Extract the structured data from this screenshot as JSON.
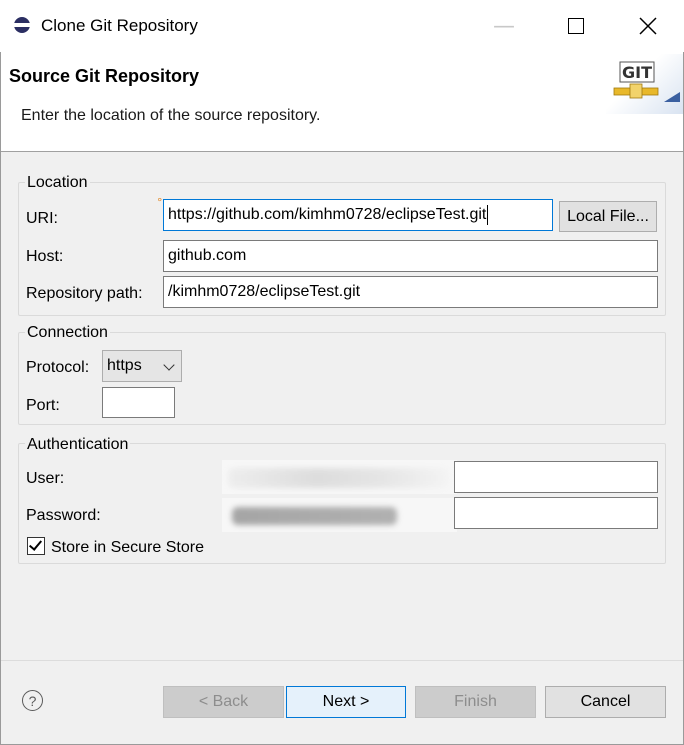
{
  "window": {
    "title": "Clone Git Repository",
    "controls": {
      "minimize": "minimize-icon",
      "maximize": "maximize-icon",
      "close": "close-icon"
    }
  },
  "header": {
    "title": "Source Git Repository",
    "description": "Enter the location of the source repository.",
    "logo_text": "GIT"
  },
  "location": {
    "group_label": "Location",
    "uri_label": "URI:",
    "uri_value": "https://github.com/kimhm0728/eclipseTest.git",
    "local_file_button": "Local File...",
    "host_label": "Host:",
    "host_value": "github.com",
    "repo_path_label": "Repository path:",
    "repo_path_value": "/kimhm0728/eclipseTest.git"
  },
  "connection": {
    "group_label": "Connection",
    "protocol_label": "Protocol:",
    "protocol_value": "https",
    "port_label": "Port:",
    "port_value": ""
  },
  "authentication": {
    "group_label": "Authentication",
    "user_label": "User:",
    "password_label": "Password:",
    "store_label": "Store in Secure Store",
    "store_checked": true
  },
  "footer": {
    "help_icon": "help-icon",
    "back_button": "< Back",
    "next_button": "Next >",
    "finish_button": "Finish",
    "cancel_button": "Cancel"
  },
  "colors": {
    "accent": "#0078d7",
    "dialog_bg": "#f0f0f0",
    "banner_bg": "#ffffff"
  }
}
